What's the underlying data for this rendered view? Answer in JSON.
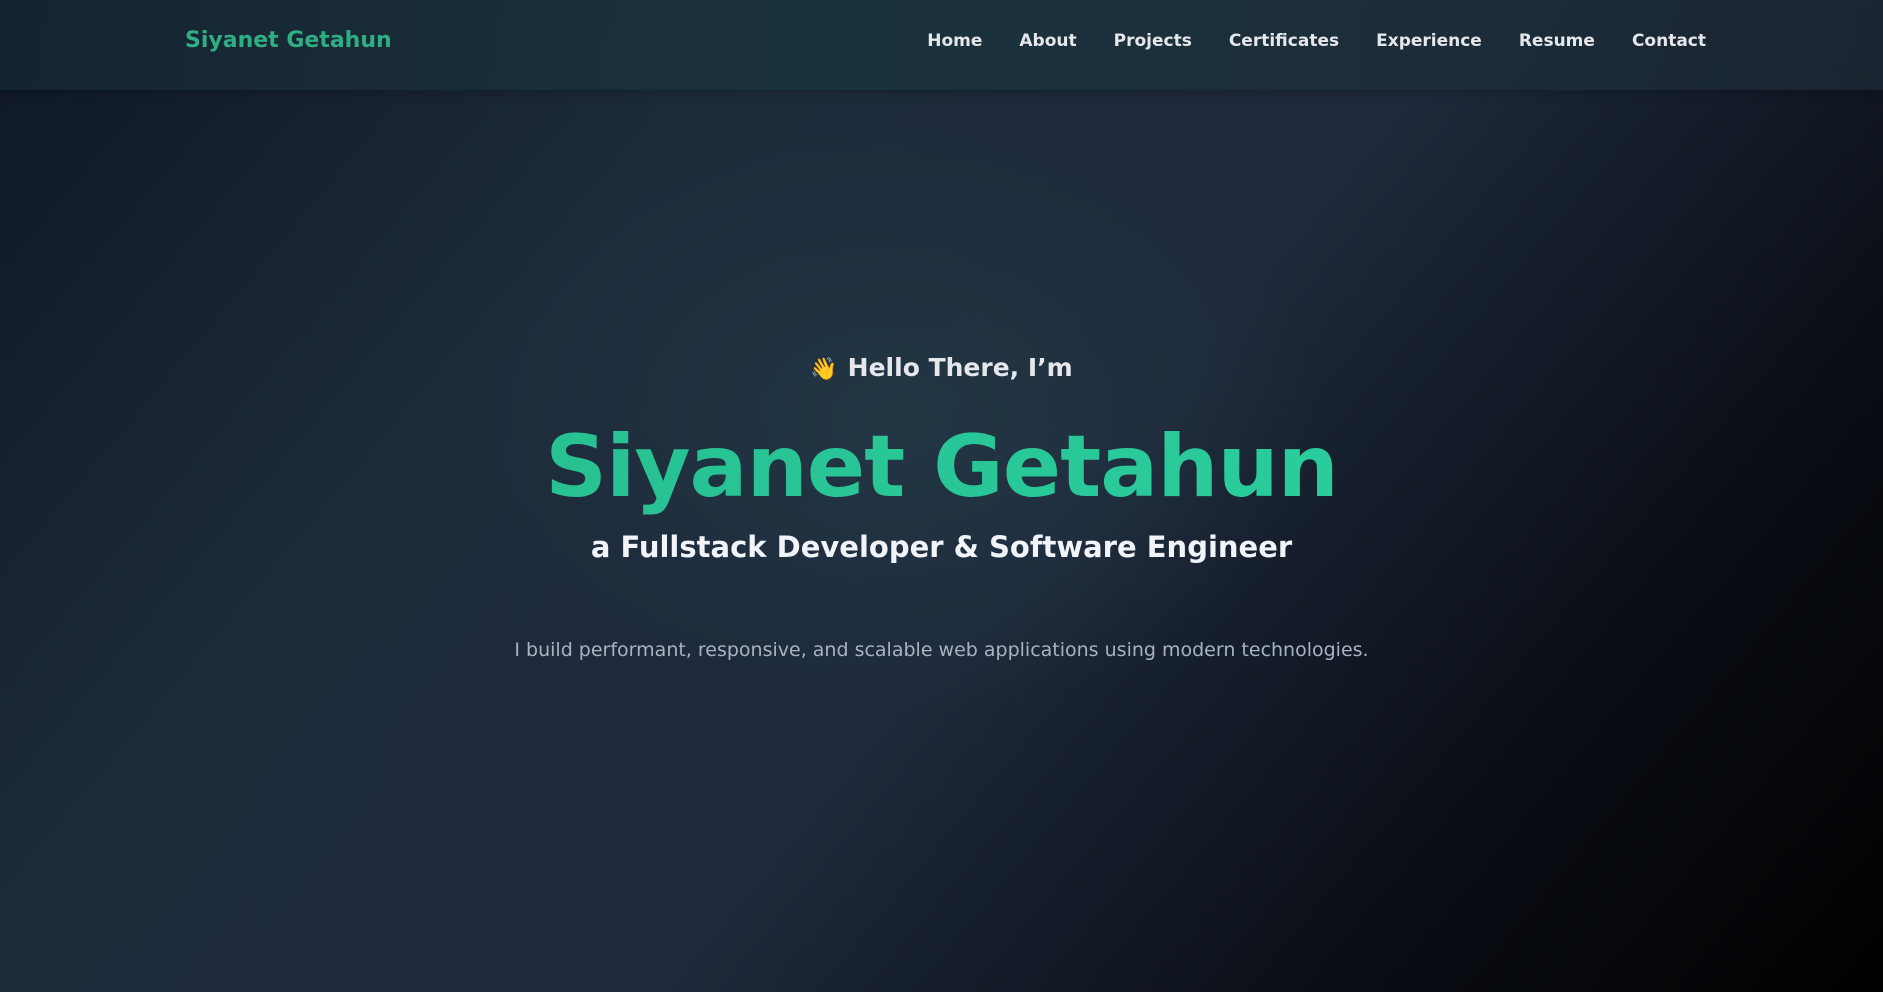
{
  "header": {
    "brand": "Siyanet Getahun",
    "nav": [
      {
        "label": "Home"
      },
      {
        "label": "About"
      },
      {
        "label": "Projects"
      },
      {
        "label": "Certificates"
      },
      {
        "label": "Experience"
      },
      {
        "label": "Resume"
      },
      {
        "label": "Contact"
      }
    ]
  },
  "hero": {
    "wave_icon": "👋",
    "greeting": "Hello There, I’m",
    "name": "Siyanet Getahun",
    "subtitle": "a Fullstack Developer & Software Engineer",
    "description": "I build performant, responsive, and scalable web applications using modern technologies."
  },
  "colors": {
    "accent": "#25c99a",
    "brand": "#2fae84",
    "background_dark": "#0f1727"
  }
}
